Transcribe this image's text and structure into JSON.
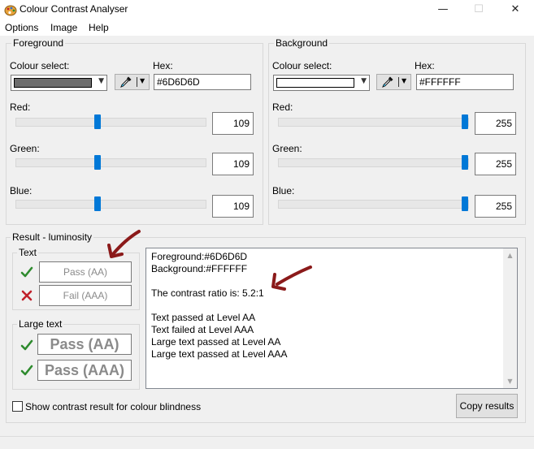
{
  "window": {
    "title": "Colour Contrast Analyser",
    "minimize_glyph": "—",
    "maximize_glyph": "☐",
    "close_glyph": "✕"
  },
  "menu": {
    "items": [
      "Options",
      "Image",
      "Help"
    ]
  },
  "foreground": {
    "group_title": "Foreground",
    "colour_select_label": "Colour select:",
    "hex_label": "Hex:",
    "hex_value": "#6D6D6D",
    "swatch_color": "#6d6d6d",
    "red_label": "Red:",
    "red": 109,
    "green_label": "Green:",
    "green": 109,
    "blue_label": "Blue:",
    "blue": 109
  },
  "background": {
    "group_title": "Background",
    "colour_select_label": "Colour select:",
    "hex_label": "Hex:",
    "hex_value": "#FFFFFF",
    "swatch_color": "#ffffff",
    "red_label": "Red:",
    "red": 255,
    "green_label": "Green:",
    "green": 255,
    "blue_label": "Blue:",
    "blue": 255
  },
  "result": {
    "group_title": "Result - luminosity",
    "text_group_title": "Text",
    "text_aa": "Pass (AA)",
    "text_aaa": "Fail (AAA)",
    "large_group_title": "Large text",
    "large_aa": "Pass (AA)",
    "large_aaa": "Pass (AAA)",
    "pass_color": "#2e8b2e",
    "fail_color": "#c0202a",
    "lines": [
      "Foreground:#6D6D6D",
      "Background:#FFFFFF",
      "",
      "The contrast ratio is: 5.2:1",
      "",
      "Text passed at Level AA",
      "Text failed at Level AAA",
      "Large text passed at Level AA",
      "Large text passed at Level AAA"
    ]
  },
  "colour_blindness_label": "Show contrast result for colour blindness",
  "copy_button": "Copy results",
  "annotation_color": "#8b1a1a",
  "accent_color": "#0078d7",
  "icons": {
    "app": "palette-icon",
    "eyedropper": "eyedropper-icon",
    "pass": "checkmark-icon",
    "fail": "cross-icon"
  }
}
